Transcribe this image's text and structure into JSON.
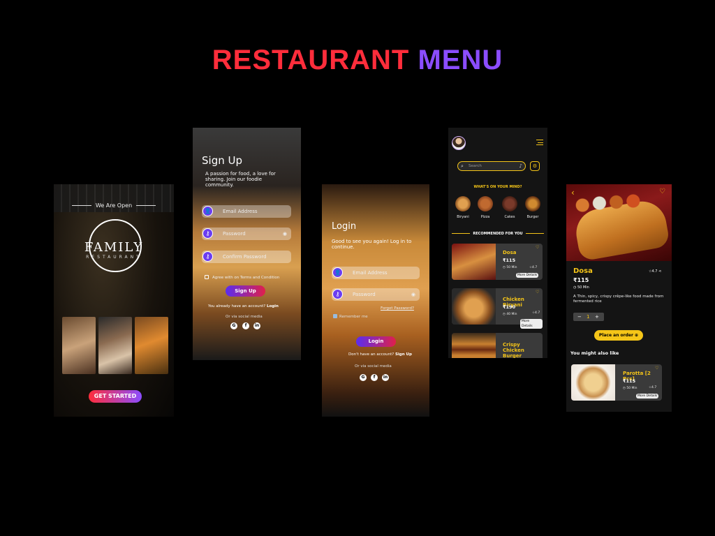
{
  "title": {
    "part1": "RESTAURANT",
    "part2": "MENU"
  },
  "welcome": {
    "status": "We Are Open",
    "brand": "FAMILY",
    "brand_sub": "RESTAURANT",
    "cta": "GET STARTED"
  },
  "signup": {
    "heading": "Sign Up",
    "tagline": "A passion for food, a love for sharing. Join our foodie community.",
    "email_placeholder": "Email Address",
    "password_placeholder": "Password",
    "confirm_placeholder": "Confirm Password",
    "agree": "Agree with on Terms and Condition",
    "button": "Sign Up",
    "already": "You already have an account?",
    "login_link": "Login",
    "or_via": "Or via social media",
    "social": [
      "G",
      "f",
      "in"
    ]
  },
  "login": {
    "heading": "Login",
    "tagline": "Good to see you again! Log in to continue.",
    "email_placeholder": "Email Address",
    "password_placeholder": "Password",
    "forgot": "Forgot Password?",
    "remember": "Remember me",
    "button": "Login",
    "no_account": "Don't have an account?",
    "signup_link": "Sign Up",
    "or_via": "Or via social media",
    "social": [
      "G",
      "f",
      "in"
    ]
  },
  "home": {
    "search_placeholder": "Search",
    "mind_heading": "WHAT'S ON YOUR MIND?",
    "categories": [
      {
        "label": "Biryani",
        "color": "#c98a3a"
      },
      {
        "label": "Pizza",
        "color": "#a0522d"
      },
      {
        "label": "Cakes",
        "color": "#5a2a20"
      },
      {
        "label": "Burger",
        "color": "#b8702a"
      }
    ],
    "recommended_heading": "RECOMMENDED FOR YOU",
    "items": [
      {
        "name": "Dosa",
        "price": "₹115",
        "time": "50 Min",
        "rating": "4.7",
        "more": "More Details"
      },
      {
        "name": "Chicken Biryani",
        "price": "₹190",
        "time": "40 Min",
        "rating": "4.7",
        "more": "More Details"
      },
      {
        "name": "Crispy Chicken Burger"
      }
    ]
  },
  "detail": {
    "name": "Dosa",
    "price": "₹115",
    "time": "50 Min",
    "rating": "4.7",
    "description": "A Thin, spicy, crispy crêpe-like food made from fermented rice",
    "qty_minus": "−",
    "qty": "1",
    "qty_plus": "+",
    "order_button": "Place an order",
    "also_like": "You might also like",
    "suggestion": {
      "name": "Parotta [2 Pcs]",
      "price": "₹115",
      "time": "50 Min",
      "rating": "4.7",
      "more": "More Details"
    }
  },
  "colors": {
    "accent_yellow": "#f5c518",
    "brand_red": "#ff2d3b",
    "brand_purple": "#8b4dff"
  }
}
